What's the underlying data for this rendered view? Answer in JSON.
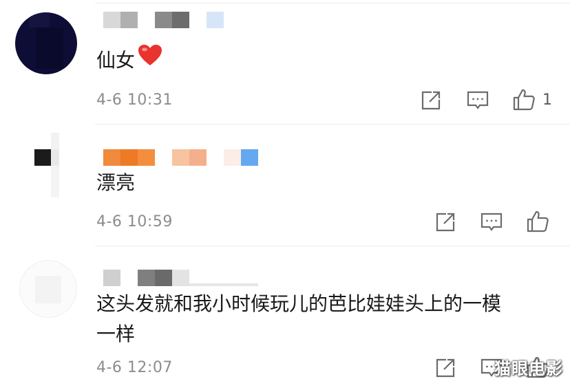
{
  "comments": [
    {
      "text": "仙女",
      "emoji": "heart-emoji",
      "time": "4-6 10:31",
      "like_count": "1"
    },
    {
      "text": "漂亮",
      "time": "4-6 10:59",
      "like_count": ""
    },
    {
      "text_line1": "这头发就和我小时候玩儿的芭比娃娃头上的一模",
      "text_line2": "一样",
      "time": "4-6 12:07",
      "like_count": ""
    }
  ],
  "icons": {
    "share": "share-icon",
    "reply": "comment-icon",
    "like": "thumbs-up-icon"
  },
  "watermark": "猫眼电影",
  "colors": {
    "time": "#8c8c8c",
    "divider": "#ececec",
    "heart": "#e8332e"
  }
}
